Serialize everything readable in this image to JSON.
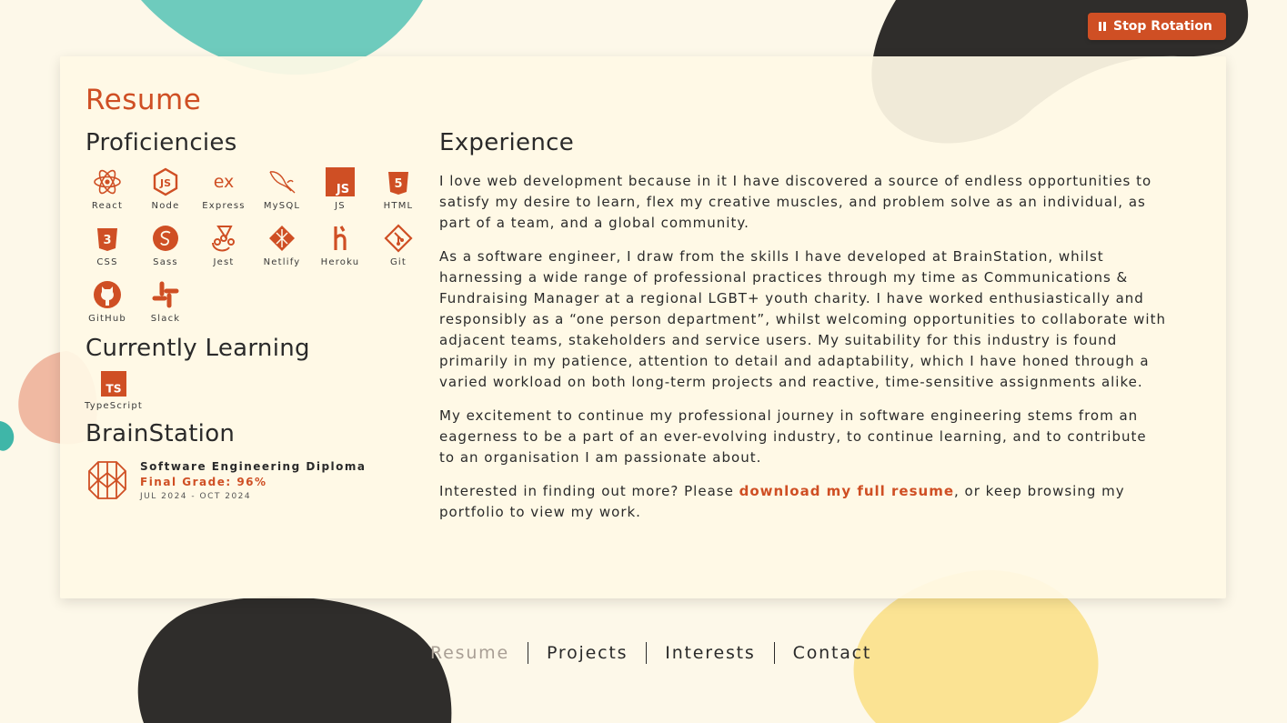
{
  "controls": {
    "stop_rotation": "Stop Rotation"
  },
  "page": {
    "title": "Resume"
  },
  "proficiencies": {
    "heading": "Proficiencies",
    "items": [
      {
        "label": "React",
        "icon": "react-icon"
      },
      {
        "label": "Node",
        "icon": "node-icon"
      },
      {
        "label": "Express",
        "icon": "express-icon"
      },
      {
        "label": "MySQL",
        "icon": "mysql-icon"
      },
      {
        "label": "JS",
        "icon": "js-icon"
      },
      {
        "label": "HTML",
        "icon": "html-icon"
      },
      {
        "label": "CSS",
        "icon": "css-icon"
      },
      {
        "label": "Sass",
        "icon": "sass-icon"
      },
      {
        "label": "Jest",
        "icon": "jest-icon"
      },
      {
        "label": "Netlify",
        "icon": "netlify-icon"
      },
      {
        "label": "Heroku",
        "icon": "heroku-icon"
      },
      {
        "label": "Git",
        "icon": "git-icon"
      },
      {
        "label": "GitHub",
        "icon": "github-icon"
      },
      {
        "label": "Slack",
        "icon": "slack-icon"
      }
    ]
  },
  "learning": {
    "heading": "Currently Learning",
    "items": [
      {
        "label": "TypeScript",
        "icon": "typescript-icon",
        "badge": "TS"
      }
    ]
  },
  "brainstation": {
    "heading": "BrainStation",
    "diploma": "Software Engineering Diploma",
    "grade": "Final Grade: 96%",
    "dates": "JUL 2024 - OCT 2024"
  },
  "experience": {
    "heading": "Experience",
    "p1": "I love web development because in it I have discovered a source of endless opportunities to satisfy my desire to learn, flex my creative muscles, and problem solve as an individual, as part of a team, and a global community.",
    "p2": "As a software engineer, I draw from the skills I have developed at BrainStation, whilst harnessing a wide range of professional practices through my time as Communications & Fundraising Manager at a regional LGBT+ youth charity. I have worked enthusiastically and responsibly as a “one person department”, whilst welcoming opportunities to collaborate with adjacent teams, stakeholders and service users. My suitability for this industry is found primarily in my patience, attention to detail and adaptability, which I have honed through a varied workload on both long-term projects and reactive, time-sensitive assignments alike.",
    "p3": "My excitement to continue my professional journey in software engineering stems from an eagerness to be a part of an ever-evolving industry, to continue learning, and to contribute to an organisation I am passionate about.",
    "p4_before": "Interested in finding out more? Please ",
    "p4_link": "download my full resume",
    "p4_after": ", or keep browsing my portfolio to view my work."
  },
  "nav": [
    "Resume",
    "Projects",
    "Interests",
    "Contact"
  ],
  "colors": {
    "accent": "#cf4f24",
    "background": "#fdf8e9",
    "card": "#fff9e5",
    "text": "#2a2a2a"
  }
}
